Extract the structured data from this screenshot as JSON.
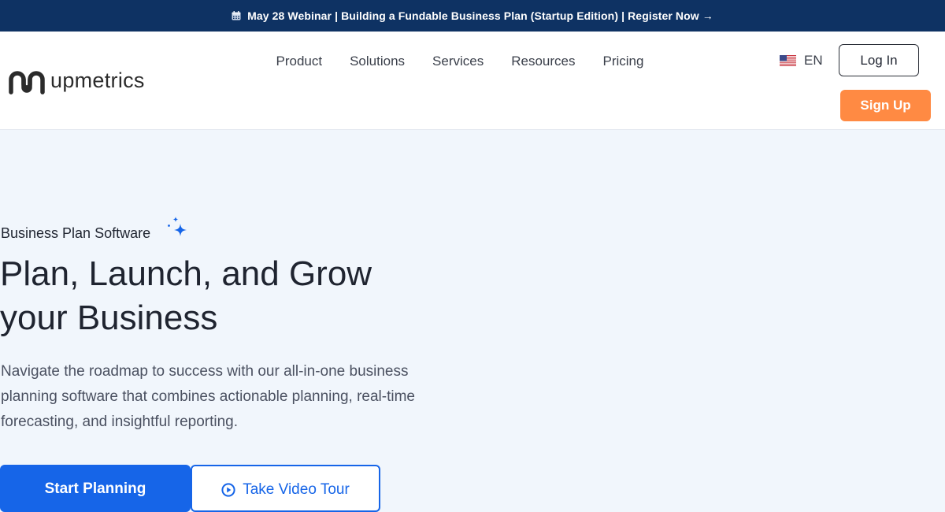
{
  "announcement": {
    "text": "May 28 Webinar | Building a Fundable Business Plan (Startup Edition) | Register Now →",
    "icon": "calendar-icon"
  },
  "header": {
    "logo_text": "upmetrics",
    "nav": [
      {
        "label": "Product"
      },
      {
        "label": "Solutions"
      },
      {
        "label": "Services"
      },
      {
        "label": "Resources"
      },
      {
        "label": "Pricing"
      }
    ],
    "language": "EN",
    "login_label": "Log In",
    "signup_label": "Sign Up"
  },
  "hero": {
    "eyebrow": "Business Plan Software",
    "title_line1": "Plan, Launch, and Grow",
    "title_line2": "your Business",
    "description": "Navigate the roadmap to success with our all-in-one business planning software that combines actionable planning, real-time forecasting, and insightful reporting.",
    "primary_cta": "Start Planning",
    "secondary_cta": "Take Video Tour"
  },
  "colors": {
    "announcement_bg": "#0e3263",
    "accent_blue": "#1665e8",
    "signup_orange": "#ff8a43",
    "hero_bg": "#f1f6fc"
  }
}
